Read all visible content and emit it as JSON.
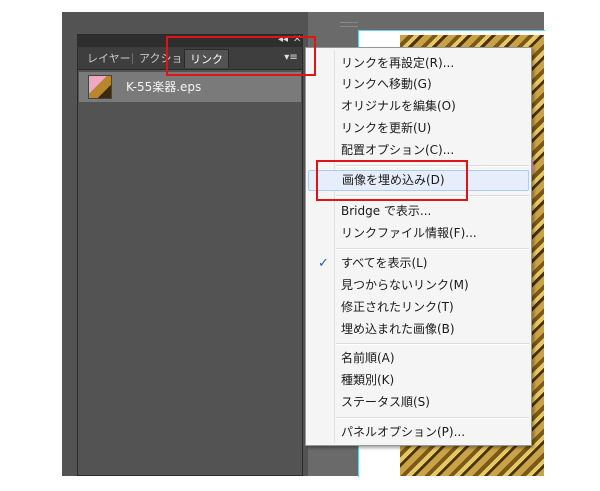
{
  "panel": {
    "tabs": [
      {
        "label": "レイヤー"
      },
      {
        "label": "アクション"
      },
      {
        "label": "リンク"
      }
    ],
    "collapse_glyph": "◂◂",
    "close_glyph": "✕",
    "menu_glyph": "▾≡",
    "links": [
      {
        "name": "K-55楽器.eps",
        "icon": "image-thumbnail-icon"
      }
    ]
  },
  "menu": {
    "items": [
      {
        "label": "リンクを再設定(R)..."
      },
      {
        "label": "リンクへ移動(G)"
      },
      {
        "label": "オリジナルを編集(O)"
      },
      {
        "label": "リンクを更新(U)"
      },
      {
        "label": "配置オプション(C)..."
      },
      {
        "label": "画像を埋め込み(D)"
      },
      {
        "label": "Bridge で表示..."
      },
      {
        "label": "リンクファイル情報(F)..."
      },
      {
        "label": "すべてを表示(L)",
        "checked": true
      },
      {
        "label": "見つからないリンク(M)"
      },
      {
        "label": "修正されたリンク(T)"
      },
      {
        "label": "埋め込まれた画像(B)"
      },
      {
        "label": "名前順(A)"
      },
      {
        "label": "種類別(K)"
      },
      {
        "label": "ステータス順(S)"
      },
      {
        "label": "パネルオプション(P)..."
      }
    ],
    "check_glyph": "✓"
  },
  "colors": {
    "highlight_box": "#e01414",
    "menu_hover": "#e6eefb",
    "check": "#1e5fbf"
  }
}
